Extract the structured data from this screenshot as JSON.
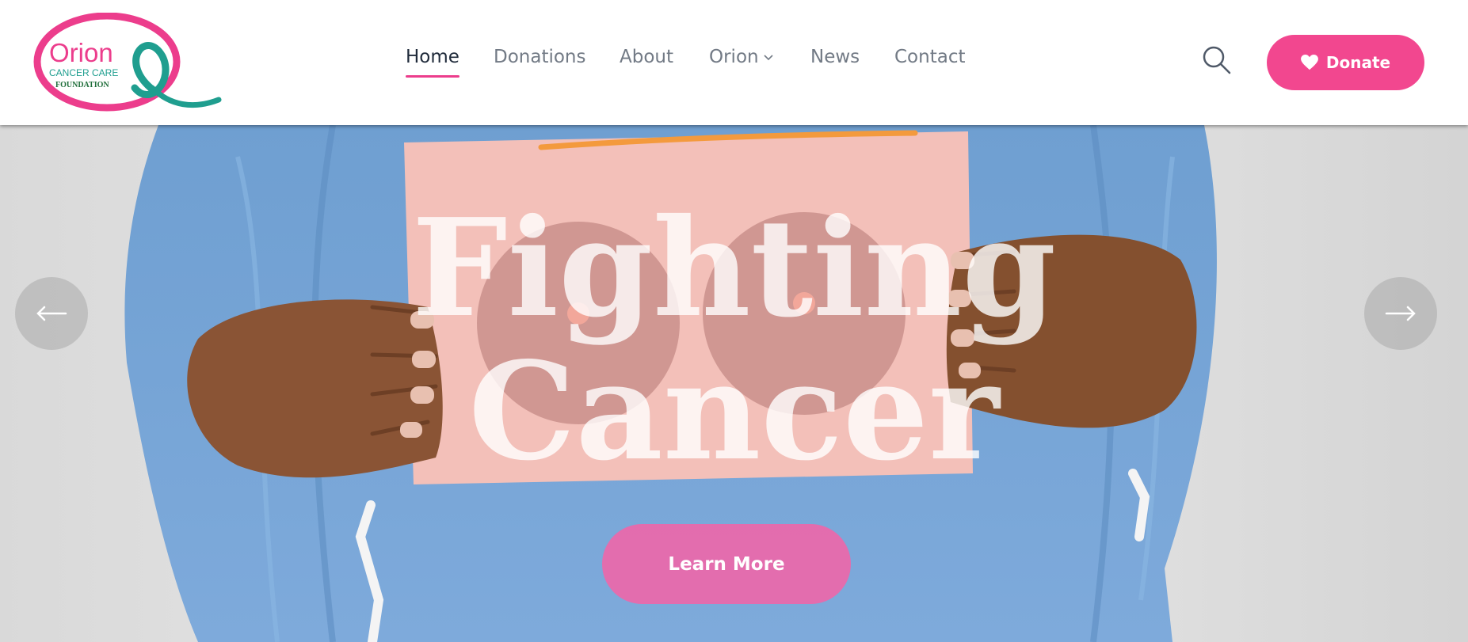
{
  "brand": {
    "name": "Orion",
    "tagline_line1": "CANCER CARE",
    "tagline_line2": "FOUNDATION",
    "pink": "#ec3d8c",
    "teal": "#1f9e8f"
  },
  "nav": {
    "home": "Home",
    "donations": "Donations",
    "about": "About",
    "orion": "Orion",
    "news": "News",
    "contact": "Contact",
    "active": "Home"
  },
  "header": {
    "search_icon": "search-icon",
    "donate_label": "Donate",
    "donate_icon": "heart-icon",
    "donate_color": "#f2478f"
  },
  "hero": {
    "title_line1": "Fighting",
    "title_line2": "Cancer",
    "cta_label": "Learn More",
    "prev_icon": "arrow-left-icon",
    "next_icon": "arrow-right-icon"
  }
}
